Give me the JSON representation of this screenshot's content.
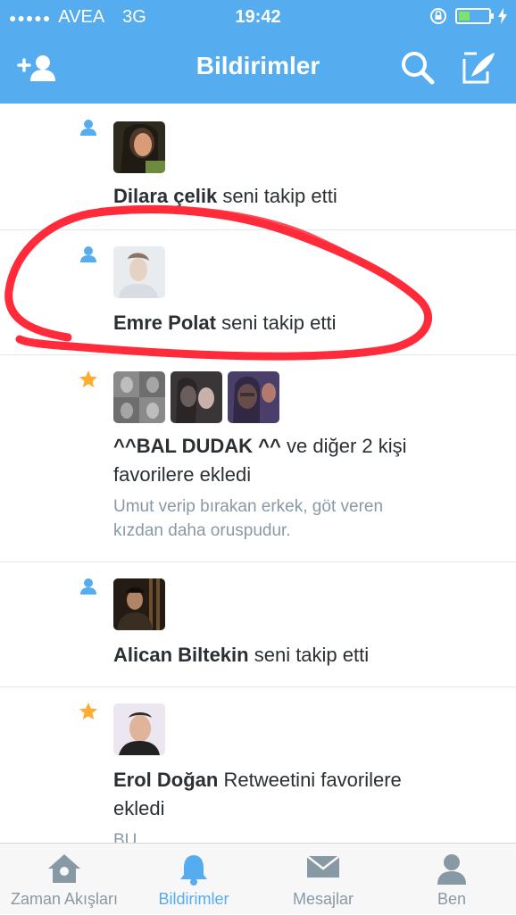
{
  "status_bar": {
    "carrier": "AVEA",
    "network": "3G",
    "time": "19:42"
  },
  "nav": {
    "title": "Bildirimler"
  },
  "notifications": [
    {
      "type": "follow",
      "name": "Dilara çelik",
      "action": "seni takip etti"
    },
    {
      "type": "follow",
      "name": "Emre Polat",
      "action": "seni takip etti"
    },
    {
      "type": "favorite",
      "name": "^^BAL DUDAK ^^",
      "action_line1": "ve diğer 2 kişi",
      "action_line2": "favorilere ekledi",
      "tweet_line1": "Umut verip bırakan erkek, göt veren",
      "tweet_line2": "kızdan daha oruspudur."
    },
    {
      "type": "follow",
      "name": "Alican Biltekin",
      "action": "seni takip etti"
    },
    {
      "type": "favorite",
      "name": "Erol Doğan",
      "action_line1": "Retweetini favorilere",
      "action_line2": "ekledi",
      "tweet_partial": "BU"
    }
  ],
  "tabs": [
    {
      "label": "Zaman Akışları",
      "icon": "home-icon"
    },
    {
      "label": "Bildirimler",
      "icon": "bell-icon",
      "active": true
    },
    {
      "label": "Mesajlar",
      "icon": "envelope-icon"
    },
    {
      "label": "Ben",
      "icon": "person-icon"
    }
  ],
  "colors": {
    "brand": "#55acee",
    "favorite": "#ffac33",
    "annotation": "#ff2b3a"
  }
}
